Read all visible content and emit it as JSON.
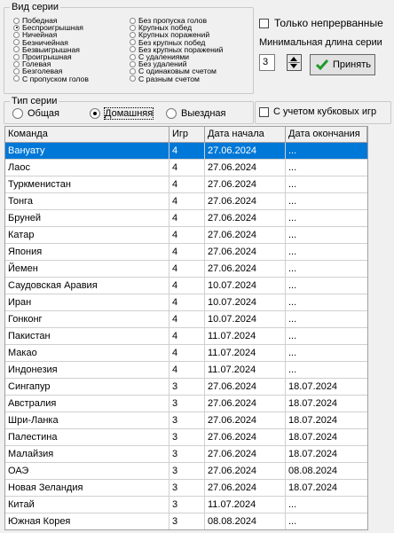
{
  "series_type": {
    "title": "Вид серии",
    "left_options": [
      "Победная",
      "Беспроигрышная",
      "Ничейная",
      "Безничейная",
      "Безвыигрышная",
      "Проигрышная",
      "Голевая",
      "Безголевая",
      "С пропуском голов"
    ],
    "right_options": [
      "Без пропуска голов",
      "Крупных побед",
      "Крупных поражений",
      "Без крупных побед",
      "Без крупных поражений",
      "С удалениями",
      "Без удалений",
      "С одинаковым счетом",
      "С разным счетом"
    ],
    "selected": "Беспроигрышная"
  },
  "options": {
    "uninterrupted_label": "Только непрерванные",
    "uninterrupted_checked": false,
    "min_length_label": "Минимальная длина серии",
    "min_length_value": "3",
    "accept_label": "Принять"
  },
  "venue": {
    "title": "Тип серии",
    "options": [
      "Общая",
      "Домашняя",
      "Выездная"
    ],
    "selected": "Домашняя"
  },
  "cup_games": {
    "label": "С учетом кубковых игр",
    "checked": false
  },
  "table": {
    "columns": [
      "Команда",
      "Игр",
      "Дата начала",
      "Дата окончания"
    ],
    "rows": [
      [
        "Вануату",
        "4",
        "27.06.2024",
        "..."
      ],
      [
        "Лаос",
        "4",
        "27.06.2024",
        "..."
      ],
      [
        "Туркменистан",
        "4",
        "27.06.2024",
        "..."
      ],
      [
        "Тонга",
        "4",
        "27.06.2024",
        "..."
      ],
      [
        "Бруней",
        "4",
        "27.06.2024",
        "..."
      ],
      [
        "Катар",
        "4",
        "27.06.2024",
        "..."
      ],
      [
        "Япония",
        "4",
        "27.06.2024",
        "..."
      ],
      [
        "Йемен",
        "4",
        "27.06.2024",
        "..."
      ],
      [
        "Саудовская Аравия",
        "4",
        "10.07.2024",
        "..."
      ],
      [
        "Иран",
        "4",
        "10.07.2024",
        "..."
      ],
      [
        "Гонконг",
        "4",
        "10.07.2024",
        "..."
      ],
      [
        "Пакистан",
        "4",
        "11.07.2024",
        "..."
      ],
      [
        "Макао",
        "4",
        "11.07.2024",
        "..."
      ],
      [
        "Индонезия",
        "4",
        "11.07.2024",
        "..."
      ],
      [
        "Сингапур",
        "3",
        "27.06.2024",
        "18.07.2024"
      ],
      [
        "Австралия",
        "3",
        "27.06.2024",
        "18.07.2024"
      ],
      [
        "Шри-Ланка",
        "3",
        "27.06.2024",
        "18.07.2024"
      ],
      [
        "Палестина",
        "3",
        "27.06.2024",
        "18.07.2024"
      ],
      [
        "Малайзия",
        "3",
        "27.06.2024",
        "18.07.2024"
      ],
      [
        "ОАЭ",
        "3",
        "27.06.2024",
        "08.08.2024"
      ],
      [
        "Новая Зеландия",
        "3",
        "27.06.2024",
        "18.07.2024"
      ],
      [
        "Китай",
        "3",
        "11.07.2024",
        "..."
      ],
      [
        "Южная Корея",
        "3",
        "08.08.2024",
        "..."
      ]
    ],
    "selected_row": 0
  },
  "colors": {
    "selection": "#0078d7",
    "accept_check": "#1f9a2a"
  },
  "icons": {
    "accept": "check-icon",
    "spinner": "spinner-arrows-icon"
  }
}
